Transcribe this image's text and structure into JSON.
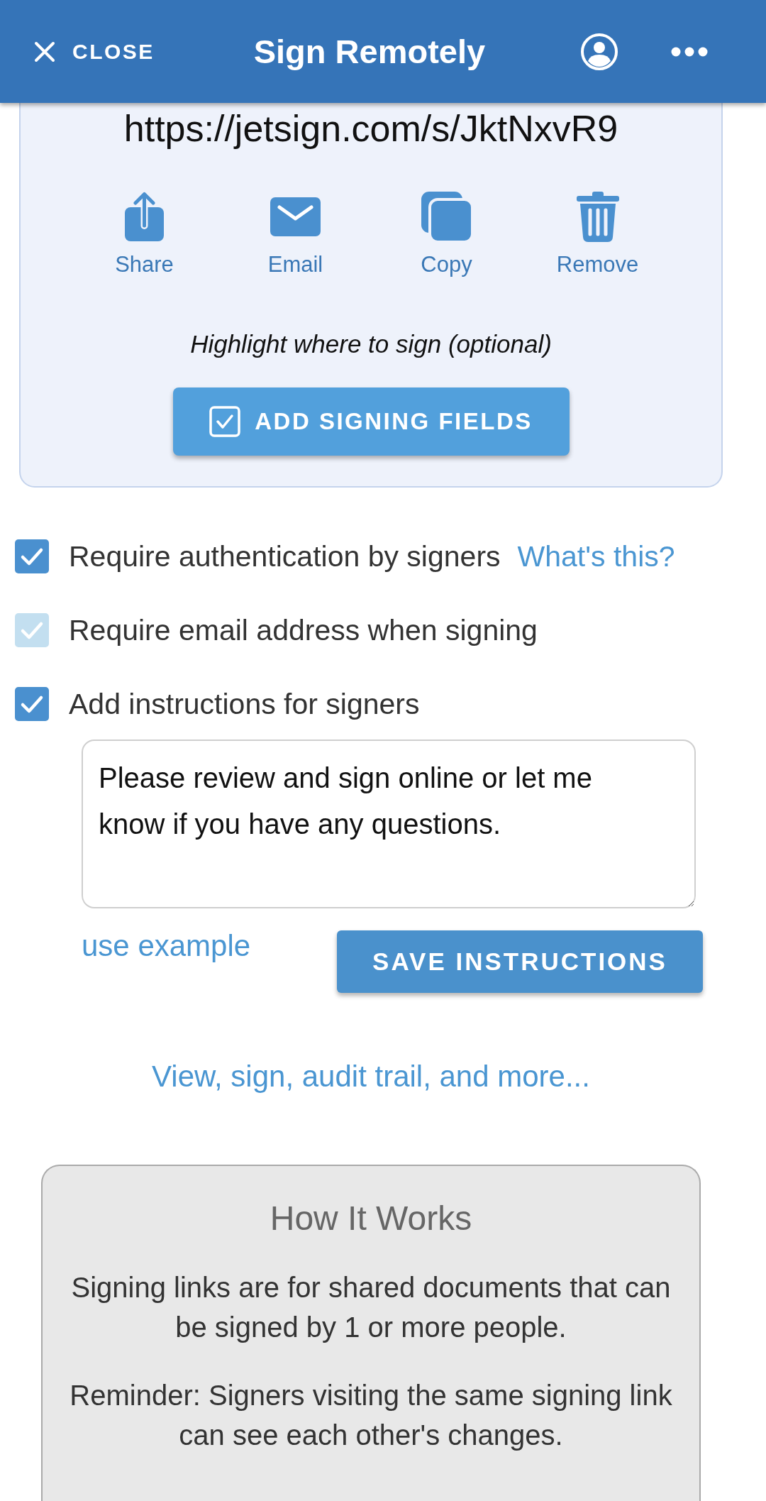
{
  "header": {
    "close_label": "CLOSE",
    "title": "Sign Remotely"
  },
  "link_panel": {
    "url": "https://jetsign.com/s/JktNxvR9",
    "actions": [
      {
        "kind": "share",
        "label": "Share"
      },
      {
        "kind": "email",
        "label": "Email"
      },
      {
        "kind": "copy",
        "label": "Copy"
      },
      {
        "kind": "remove",
        "label": "Remove"
      }
    ],
    "hint": "Highlight where to sign (optional)",
    "button": "ADD SIGNING FIELDS"
  },
  "options": [
    {
      "label": "Require authentication by signers",
      "checked": true,
      "disabled": false,
      "link": "What's this?"
    },
    {
      "label": "Require email address when signing",
      "checked": true,
      "disabled": true
    },
    {
      "label": "Add instructions for signers",
      "checked": true,
      "disabled": false
    }
  ],
  "instructions": {
    "value": "Please review and sign online or let me know if you have any questions.",
    "link": "use example",
    "button": "SAVE INSTRUCTIONS"
  },
  "more_link": "View, sign, audit trail, and more...",
  "how_it_works": {
    "title": "How It Works",
    "paragraphs": [
      "Signing links are for shared documents that can be signed by 1 or more people.",
      "Reminder: Signers visiting the same signing link can see each other's changes."
    ]
  }
}
